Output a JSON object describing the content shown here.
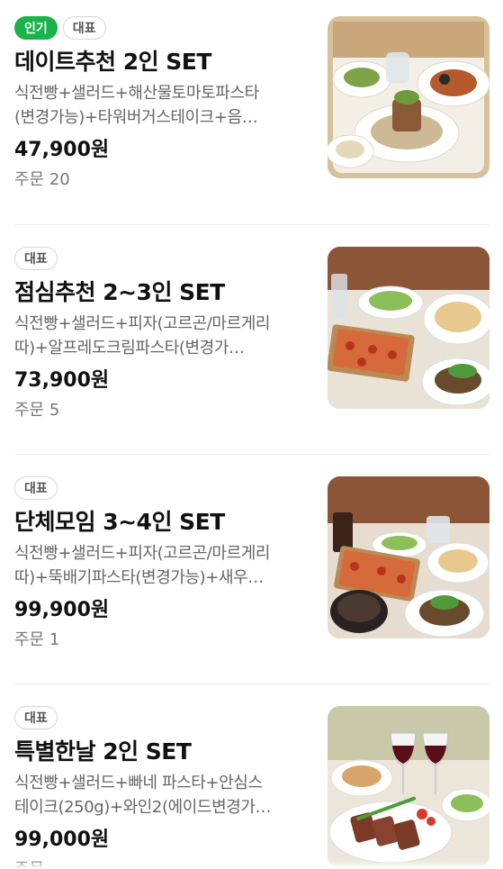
{
  "menu_items": [
    {
      "badges": [
        "인기",
        "대표"
      ],
      "title": "데이트추천 2인 SET",
      "desc_line1": "식전빵+샐러드+해산물토마토파스타",
      "desc_line2": "(변경가능)+타워버거스테이크+음…",
      "price": "47,900원",
      "orders": "주문 20",
      "image": "date-set-food-photo"
    },
    {
      "badges": [
        "대표"
      ],
      "title": "점심추천 2~3인 SET",
      "desc_line1": "식전빵+샐러드+피자(고르곤/마르게리",
      "desc_line2": "따)+알프레도크림파스타(변경가…",
      "price": "73,900원",
      "orders": "주문 5",
      "image": "lunch-set-food-photo"
    },
    {
      "badges": [
        "대표"
      ],
      "title": "단체모임 3~4인 SET",
      "desc_line1": "식전빵+샐러드+피자(고르곤/마르게리",
      "desc_line2": "따)+뚝배기파스타(변경가능)+새우…",
      "price": "99,900원",
      "orders": "주문 1",
      "image": "group-set-food-photo"
    },
    {
      "badges": [
        "대표"
      ],
      "title": "특별한날 2인 SET",
      "desc_line1": "식전빵+샐러드+빠네 파스타+안심스",
      "desc_line2": "테이크(250g)+와인2(에이드변경가…",
      "price": "99,000원",
      "orders": "주문",
      "image": "special-day-set-food-photo"
    }
  ],
  "colors": {
    "popular_badge": "#19b34a",
    "rep_badge_border": "#d6d6d6",
    "desc_text": "#666666"
  }
}
